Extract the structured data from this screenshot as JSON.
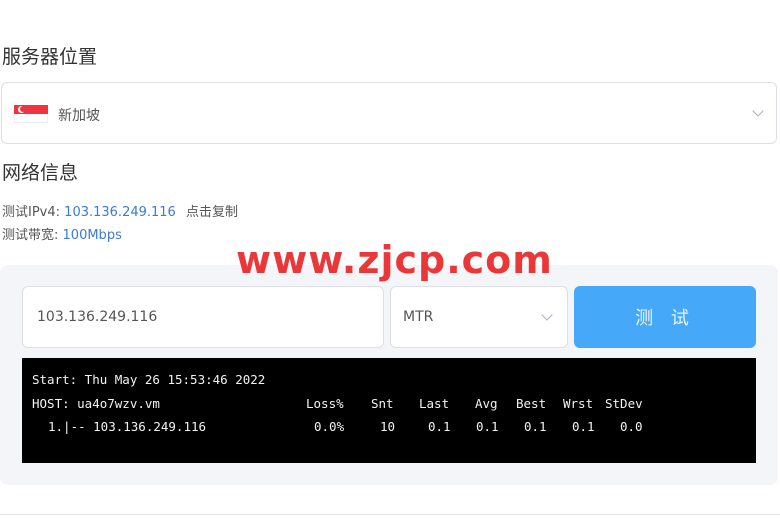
{
  "server_location": {
    "title": "服务器位置",
    "selected": "新加坡",
    "flag_icon": "singapore-flag-icon"
  },
  "network_info": {
    "title": "网络信息",
    "ipv4_label": "测试IPv4:",
    "ipv4_value": "103.136.249.116",
    "copy_label": "点击复制",
    "bandwidth_label": "测试带宽:",
    "bandwidth_value": "100Mbps"
  },
  "watermark": "www.zjcp.com",
  "test_panel": {
    "host_input_value": "103.136.249.116",
    "mode_selected": "MTR",
    "test_button_label": "测 试"
  },
  "terminal": {
    "start_line": "Start: Thu May 26 15:53:46 2022",
    "host_label": "HOST: ua4o7wzv.vm",
    "columns": [
      "Loss%",
      "Snt",
      "Last",
      "Avg",
      "Best",
      "Wrst",
      "StDev"
    ],
    "rows": [
      {
        "hop": "1.|-- 103.136.249.116",
        "values": [
          "0.0%",
          "10",
          "0.1",
          "0.1",
          "0.1",
          "0.1",
          "0.0"
        ]
      }
    ]
  },
  "colors": {
    "accent_button": "#46a8f8",
    "link_blue": "#3a7bd5",
    "panel_bg": "#f3f5f9",
    "terminal_bg": "#000000",
    "watermark": "#e61414"
  }
}
